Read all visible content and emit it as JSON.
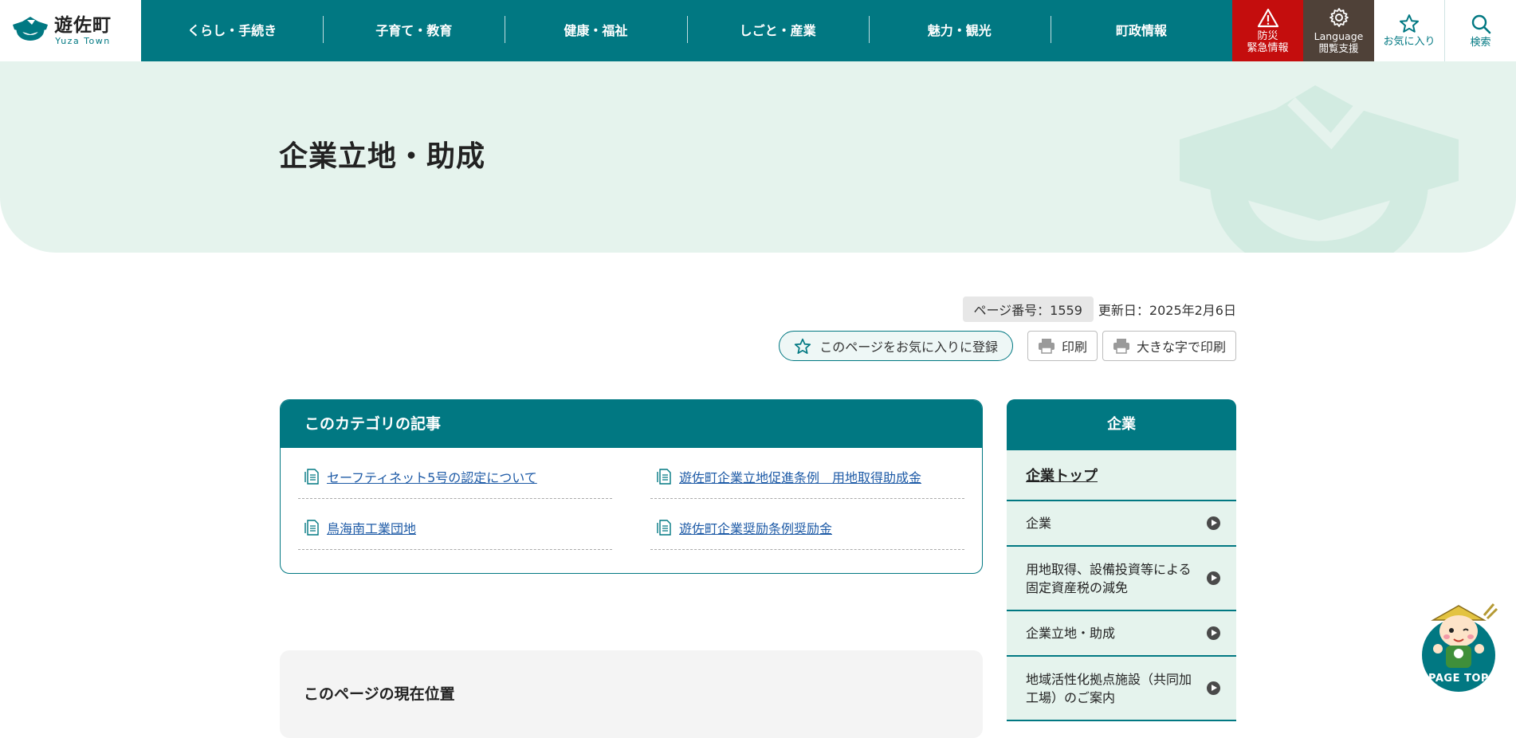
{
  "header": {
    "logo_name": "遊佐町",
    "logo_sub": "Yuza Town",
    "nav": [
      "くらし・手続き",
      "子育て・教育",
      "健康・福祉",
      "しごと・産業",
      "魅力・観光",
      "町政情報"
    ],
    "disaster": {
      "line1": "防災",
      "line2": "緊急情報"
    },
    "language": {
      "line1": "Language",
      "line2": "閲覧支援"
    },
    "favorite_label": "お気に入り",
    "search_label": "検索"
  },
  "hero": {
    "title": "企業立地・助成"
  },
  "meta": {
    "page_number": "ページ番号：1559",
    "updated": "更新日：2025年2月6日"
  },
  "tools": {
    "favorite": "このページをお気に入りに登録",
    "print": "印刷",
    "print_large": "大きな字で印刷"
  },
  "category": {
    "heading": "このカテゴリの記事",
    "items": [
      "セーフティネット5号の認定について",
      "遊佐町企業立地促進条例　用地取得助成金",
      "鳥海南工業団地",
      "遊佐町企業奨励条例奨励金"
    ]
  },
  "breadcrumb": {
    "heading": "このページの現在位置"
  },
  "sidebar": {
    "heading": "企業",
    "top": "企業トップ",
    "items": [
      "企業",
      "用地取得、設備投資等による固定資産税の減免",
      "企業立地・助成",
      "地域活性化拠点施設（共同加工場）のご案内"
    ]
  },
  "pagetop": {
    "label": "PAGE TOP"
  },
  "colors": {
    "primary": "#017882",
    "light": "#e5f3ed",
    "disaster": "#c40d0d",
    "language": "#4f4138",
    "link": "#1d5aa6"
  }
}
